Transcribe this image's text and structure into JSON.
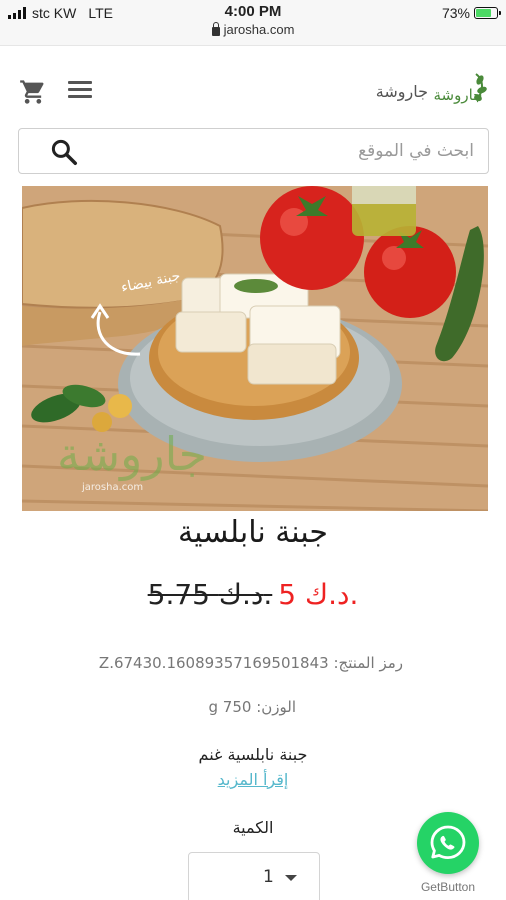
{
  "status_bar": {
    "carrier": "stc KW",
    "network": "LTE",
    "time": "4:00 PM",
    "url": "jarosha.com",
    "battery": "73%",
    "battery_level": 0.73
  },
  "header": {
    "brand_name": "جاروشة",
    "logo_text": "جاروشة",
    "cart_icon": "cart-icon",
    "menu_icon": "hamburger-menu-icon"
  },
  "search": {
    "placeholder": "ابحث في الموقع",
    "icon": "search-icon"
  },
  "product": {
    "image_label": "جبنة بيضاء",
    "watermark": "جاروشة",
    "watermark_url": "jarosha.com",
    "title": "جبنة نابلسية",
    "new_price": "5 د.ك.",
    "old_price": "5.75 د.ك.",
    "sku": "رمز المنتج: Z.67430.16089357169501843",
    "weight": "الوزن: 750 g",
    "description": "جبنة نابلسية غنم",
    "read_more": "إقرأ المزيد",
    "quantity_label": "الكمية",
    "quantity_value": "1"
  },
  "whatsapp": {
    "label": "GetButton",
    "icon": "whatsapp-icon",
    "color": "#25d366"
  },
  "colors": {
    "price_red": "#e22222",
    "link_blue": "#56b8cc",
    "logo_green": "#4a8a3a"
  }
}
